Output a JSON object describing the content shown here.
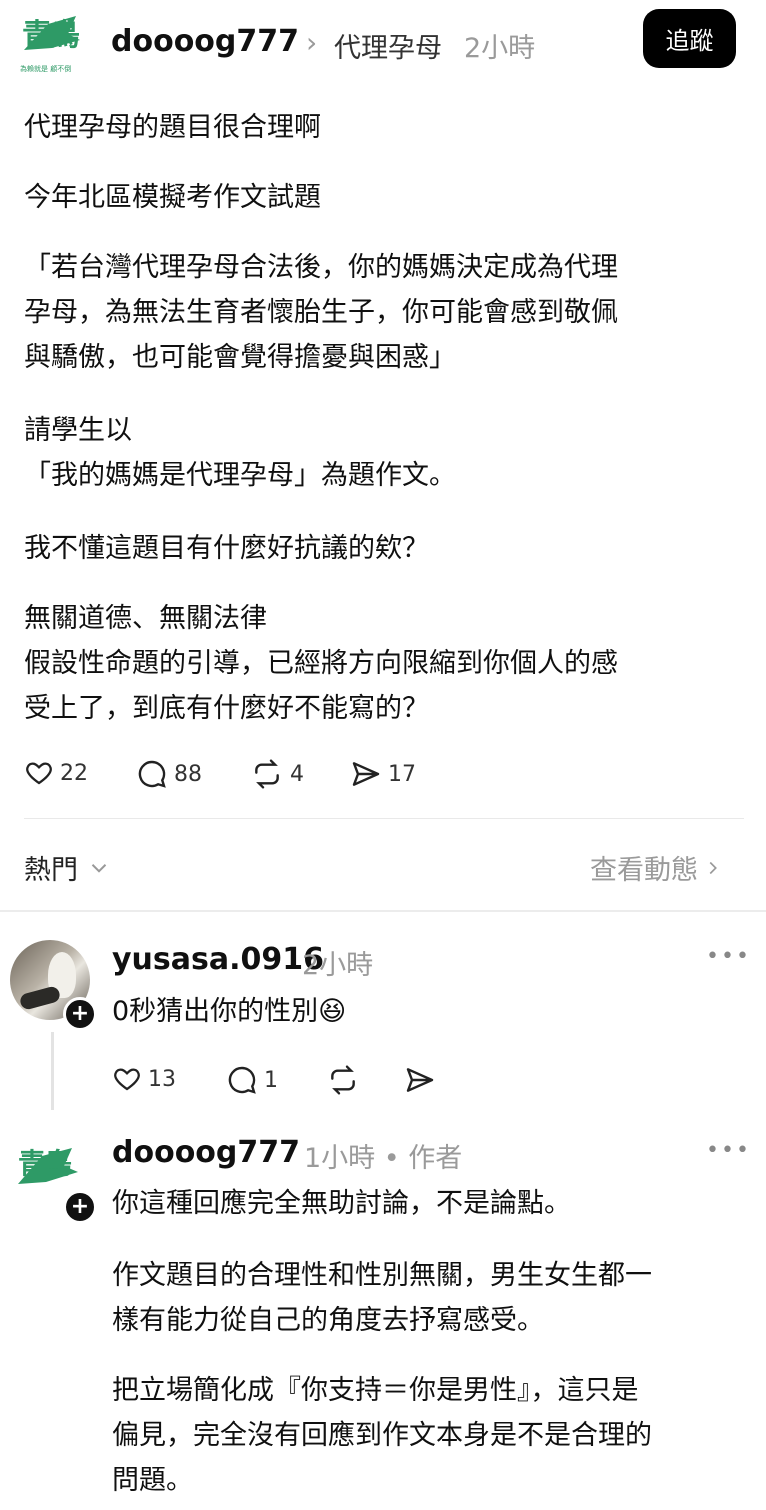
{
  "post": {
    "logo_text": "青鳥",
    "logo_caption": "為賴就是 顧不倒",
    "author": "doooog777",
    "topic": "代理孕母",
    "time": "2小時",
    "follow_label": "追蹤",
    "paragraphs": [
      "代理孕母的題目很合理啊",
      "今年北區模擬考作文試題",
      "「若台灣代理孕母合法後，你的媽媽決定成為代理\n孕母，為無法生育者懷胎生子，你可能會感到敬佩\n與驕傲，也可能會覺得擔憂與困惑」",
      "請學生以\n「我的媽媽是代理孕母」為題作文。",
      "我不懂這題目有什麼好抗議的欸？",
      "無關道德、無關法律\n假設性命題的引導，已經將方向限縮到你個人的感\n受上了，到底有什麼好不能寫的？"
    ],
    "stats": {
      "likes": "22",
      "comments": "88",
      "reposts": "4",
      "shares": "17"
    }
  },
  "sort": {
    "label": "熱門",
    "activity_label": "查看動態"
  },
  "replies": [
    {
      "author": "yusasa.0916",
      "time": "2小時",
      "text": "0秒猜出你的性別😆",
      "stats": {
        "likes": "13",
        "comments": "1"
      }
    },
    {
      "author": "doooog777",
      "time": "1小時",
      "tag": "作者",
      "logo_text": "青鳥",
      "paragraphs": [
        "你這種回應完全無助討論，不是論點。",
        "作文題目的合理性和性別無關，男生女生都一\n樣有能力從自己的角度去抒寫感受。",
        "把立場簡化成『你支持＝你是男性』，這只是\n偏見，完全沒有回應到作文本身是不是合理的\n問題。"
      ]
    }
  ],
  "colors": {
    "brand_green": "#2e9a66",
    "text": "#101010",
    "muted": "#9a9a9a"
  }
}
